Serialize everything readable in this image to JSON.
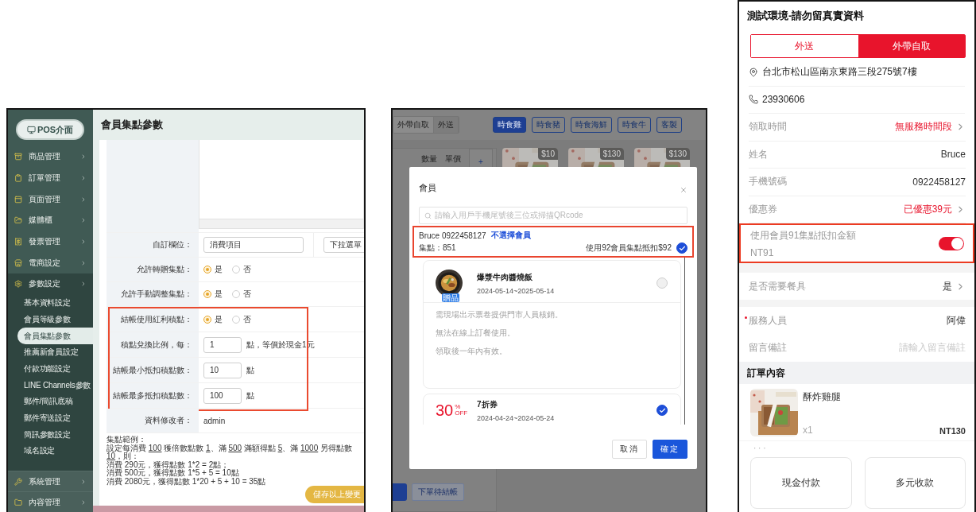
{
  "admin_panel": {
    "sidebar": {
      "pos_button": "POS介面",
      "items": [
        {
          "label": "商品管理",
          "expanded": false
        },
        {
          "label": "訂單管理",
          "expanded": false
        },
        {
          "label": "頁面管理",
          "expanded": false
        },
        {
          "label": "媒體櫃",
          "expanded": false
        },
        {
          "label": "發票管理",
          "expanded": false
        },
        {
          "label": "電商設定",
          "expanded": false
        },
        {
          "label": "參數設定",
          "expanded": true,
          "children": [
            {
              "label": "基本資料設定",
              "selected": false
            },
            {
              "label": "會員等級參數",
              "selected": false
            },
            {
              "label": "會員集點參數",
              "selected": true
            },
            {
              "label": "推薦新會員設定",
              "selected": false
            },
            {
              "label": "付款功能設定",
              "selected": false
            },
            {
              "label": "LINE Channels參數",
              "selected": false
            },
            {
              "label": "郵件/簡訊底稿",
              "selected": false
            },
            {
              "label": "郵件寄送設定",
              "selected": false
            },
            {
              "label": "簡訊參數設定",
              "selected": false
            },
            {
              "label": "域名設定",
              "selected": false
            }
          ]
        },
        {
          "label": "系統管理",
          "expanded": false
        },
        {
          "label": "內容管理",
          "expanded": false
        }
      ]
    },
    "page_title": "會員集點參數",
    "form": {
      "sections": [
        {
          "highlighted": false,
          "rows": [
            {
              "kind": "textarea"
            },
            {
              "kind": "custom_field",
              "label": "自訂欄位：",
              "value": "消費項目",
              "select": "下拉選單"
            },
            {
              "kind": "radio",
              "label": "允許轉贈集點：",
              "options": [
                {
                  "label": "是",
                  "selected": true
                },
                {
                  "label": "否",
                  "selected": false
                }
              ]
            },
            {
              "kind": "radio",
              "label": "允許手動調整集點：",
              "options": [
                {
                  "label": "是",
                  "selected": true
                },
                {
                  "label": "否",
                  "selected": false
                }
              ]
            }
          ]
        },
        {
          "highlighted": true,
          "rows": [
            {
              "kind": "radio",
              "label": "結帳使用紅利積點：",
              "options": [
                {
                  "label": "是",
                  "selected": true
                },
                {
                  "label": "否",
                  "selected": false
                }
              ]
            },
            {
              "kind": "number",
              "label": "積點兌換比例，每：",
              "value": "1",
              "suffix": "點，等價於現金1元"
            },
            {
              "kind": "number",
              "label": "結帳最小抵扣積點數：",
              "value": "10",
              "suffix": "點"
            },
            {
              "kind": "number",
              "label": "結帳最多抵扣積點數：",
              "value": "100",
              "suffix": "點"
            }
          ]
        },
        {
          "highlighted": false,
          "rows": [
            {
              "kind": "text",
              "label": "資料修改者：",
              "value": "admin"
            }
          ]
        }
      ]
    },
    "example": {
      "title": "集點範例：",
      "lines": [
        [
          {
            "text": "設定每消費 ",
            "kind": "plain"
          },
          {
            "text": "100",
            "kind": "underlined"
          },
          {
            "text": " 獲倍數點數 ",
            "kind": "plain"
          },
          {
            "text": "1",
            "kind": "underlined"
          },
          {
            "text": "、滿 ",
            "kind": "plain"
          },
          {
            "text": "500",
            "kind": "underlined"
          },
          {
            "text": " 滿額得點 ",
            "kind": "plain"
          },
          {
            "text": "5",
            "kind": "underlined"
          },
          {
            "text": "、滿 ",
            "kind": "plain"
          },
          {
            "text": "1000",
            "kind": "underlined"
          },
          {
            "text": " 另得點數 ",
            "kind": "plain"
          },
          {
            "text": "10",
            "kind": "underlined"
          },
          {
            "text": "，則：",
            "kind": "plain"
          }
        ],
        [
          {
            "text": "消費 290元，獲得點數 1*2 = 2點；",
            "kind": "plain"
          }
        ],
        [
          {
            "text": "消費 500元，獲得點數 1*5 + 5 = 10點",
            "kind": "plain"
          }
        ],
        [
          {
            "text": "消費 2080元，獲得點數 1*20 + 5 + 10 = 35點",
            "kind": "plain"
          }
        ]
      ]
    },
    "save_button": "儲存以上變更"
  },
  "pos_panel": {
    "order_types": [
      {
        "label": "外帶自取",
        "selected": true
      },
      {
        "label": "外送",
        "selected": false
      }
    ],
    "categories": [
      {
        "label": "時食雞",
        "selected": true
      },
      {
        "label": "時食豬",
        "selected": false
      },
      {
        "label": "時食海鮮",
        "selected": false
      },
      {
        "label": "時食牛",
        "selected": false
      },
      {
        "label": "客製",
        "selected": false
      }
    ],
    "order_columns": [
      "數量",
      "單價"
    ],
    "add_button": "+",
    "products": [
      {
        "price": "$10"
      },
      {
        "price": "$130"
      },
      {
        "price": "$130"
      }
    ],
    "pending_button": "下單待結帳",
    "modal": {
      "title": "會員",
      "search_placeholder": "請輸入用戶手機尾號後三位或掃描QRcode",
      "member": {
        "name_phone": "Bruce 0922458127",
        "deselect_link": "不選擇會員",
        "points": "集點：851",
        "redeem": "使用92會員集點抵扣$92",
        "checked": true,
        "highlighted": true
      },
      "coupons": [
        {
          "kind": "gift",
          "badge": "贈品",
          "name": "爆漿牛肉醬燒飯",
          "dates": "2024-05-14~2025-05-14",
          "checked": false,
          "notes": [
            "需現場出示票卷提供門市人員核銷。",
            "無法在線上訂餐使用。",
            "領取後一年內有效。"
          ]
        },
        {
          "kind": "discount",
          "amount": "30",
          "unit": "%",
          "off": "OFF",
          "name": "7折券",
          "dates": "2024-04-24~2024-05-24",
          "checked": true
        }
      ],
      "buttons": [
        {
          "label": "取消",
          "kind": "secondary"
        },
        {
          "label": "確定",
          "kind": "primary"
        }
      ]
    }
  },
  "mobile_panel": {
    "title": "測試環境-請勿留真實資料",
    "modes": [
      {
        "label": "外送",
        "selected": false
      },
      {
        "label": "外帶自取",
        "selected": true
      }
    ],
    "address": "台北市松山區南京東路三段275號7樓",
    "phone": "23930606",
    "rows": [
      {
        "kind": "link",
        "label": "領取時間",
        "value": "無服務時間段",
        "accent": true
      },
      {
        "kind": "text",
        "label": "姓名",
        "value": "Bruce",
        "accent": false
      },
      {
        "kind": "text",
        "label": "手機號碼",
        "value": "0922458127",
        "accent": false
      },
      {
        "kind": "link",
        "label": "優惠券",
        "value": "已優惠39元",
        "accent": true
      }
    ],
    "points_toggle": {
      "label": "使用會員91集點抵扣金額",
      "amount": "NT91",
      "on": true,
      "highlighted": true
    },
    "utensils": {
      "label": "是否需要餐具",
      "value": "是"
    },
    "staff": {
      "label": "服務人員",
      "value": "阿偉",
      "required": true
    },
    "note": {
      "label": "留言備註",
      "placeholder": "請輸入留言備註"
    },
    "order": {
      "title": "訂單內容",
      "items": [
        {
          "name": "酥炸雞腿",
          "qty": "x1",
          "price": "NT130"
        }
      ]
    },
    "more": "· · ·",
    "pay_buttons": [
      "現金付款",
      "多元收款"
    ]
  }
}
